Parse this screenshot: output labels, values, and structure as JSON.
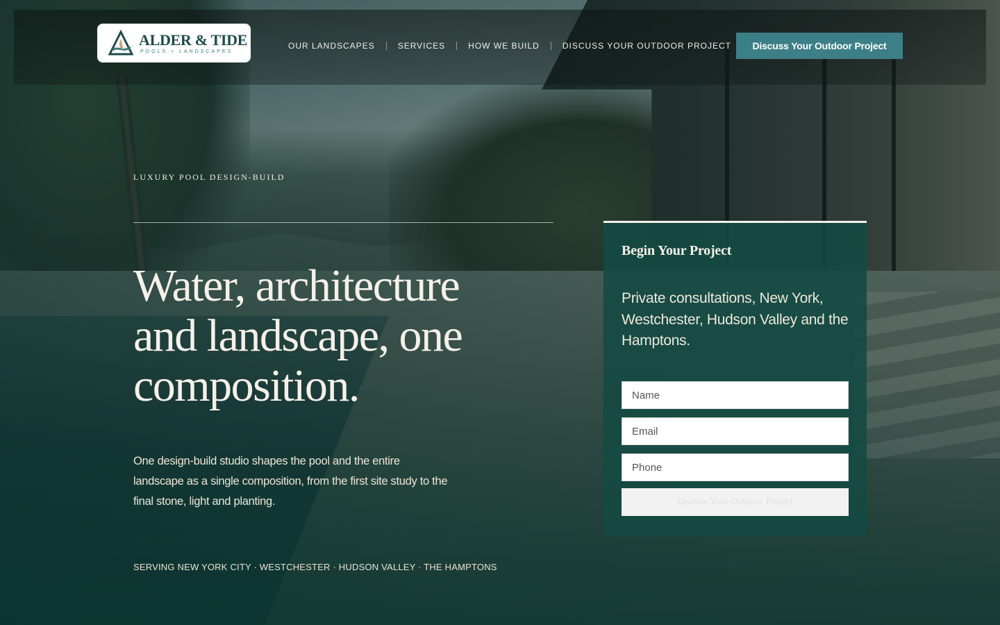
{
  "header": {
    "logo": {
      "name": "ALDER & TIDE",
      "subtitle": "POOLS + LANDSCAPES"
    },
    "nav": [
      "OUR LANDSCAPES",
      "SERVICES",
      "HOW WE BUILD",
      "DISCUSS YOUR OUTDOOR PROJECT"
    ],
    "cta_label": "Discuss Your Outdoor Project"
  },
  "hero": {
    "eyebrow": "LUXURY POOL DESIGN-BUILD",
    "headline": "Water, architecture and landscape, one composition.",
    "body": "One design-build studio shapes the pool and the entire landscape as a single composition, from the first site study to the final stone, light and planting.",
    "regions": "SERVING NEW YORK CITY · WESTCHESTER · HUDSON VALLEY · THE HAMPTONS"
  },
  "form": {
    "title": "Begin Your Project",
    "text": "Private consultations, New York, Westchester, Hudson Valley and the Hamptons.",
    "name_placeholder": "Name",
    "email_placeholder": "Email",
    "phone_placeholder": "Phone",
    "submit_label": "Discuss Your Outdoor Project"
  },
  "colors": {
    "accent": "#3c7f86",
    "card": "#144a42",
    "text": "#f5f1e8"
  }
}
